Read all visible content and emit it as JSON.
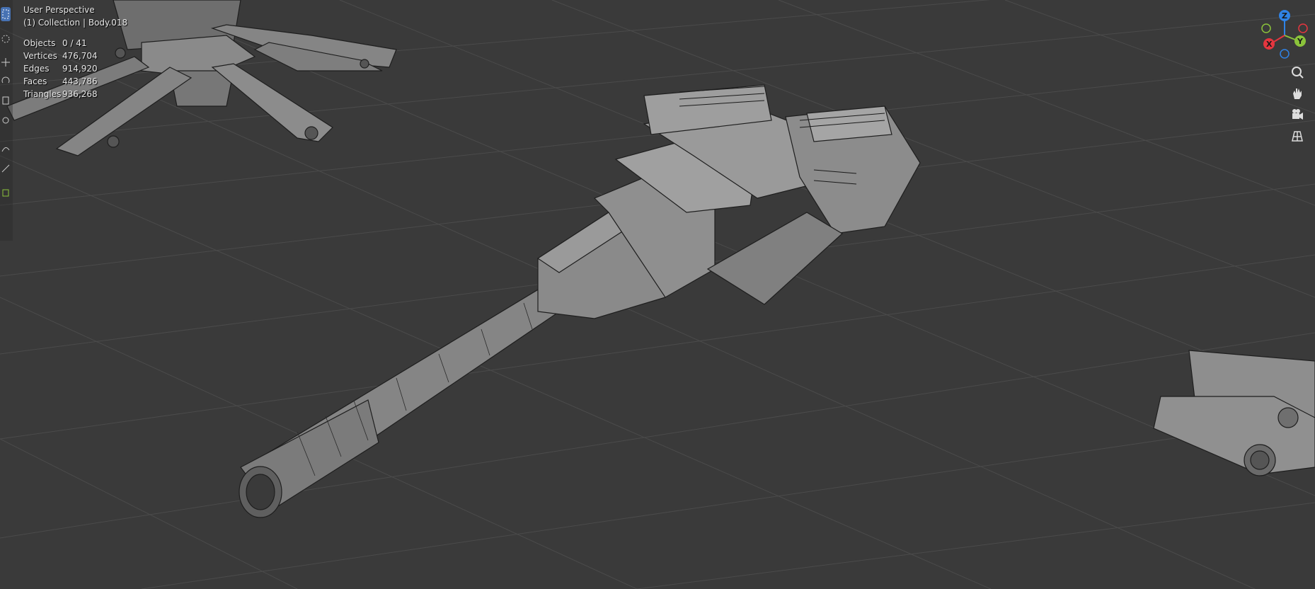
{
  "viewport": {
    "view_name": "User Perspective",
    "collection_line": "(1) Collection | Body.018"
  },
  "stats": [
    {
      "label": "Objects",
      "value": "0 / 41"
    },
    {
      "label": "Vertices",
      "value": "476,704"
    },
    {
      "label": "Edges",
      "value": "914,920"
    },
    {
      "label": "Faces",
      "value": "443,786"
    },
    {
      "label": "Triangles",
      "value": "936,268"
    }
  ],
  "gizmo": {
    "z_label": "Z",
    "y_label": "Y",
    "x_label": "X",
    "colors": {
      "x": "#e5363f",
      "y": "#8bc33b",
      "z": "#2f83e6"
    }
  },
  "nav_buttons": [
    "zoom-icon",
    "hand-pan-icon",
    "camera-icon",
    "grid-ortho-icon"
  ],
  "toolbar_tools": [
    "select-box-icon",
    "cursor-icon",
    "move-icon",
    "rotate-icon",
    "scale-icon",
    "transform-icon",
    "annotate-icon",
    "measure-icon",
    "add-cube-icon"
  ],
  "theme": {
    "background": "#3b3b3b",
    "grid": "#4a4a4a",
    "mesh": "#7d7d7d",
    "wire": "#1e1e1e"
  }
}
